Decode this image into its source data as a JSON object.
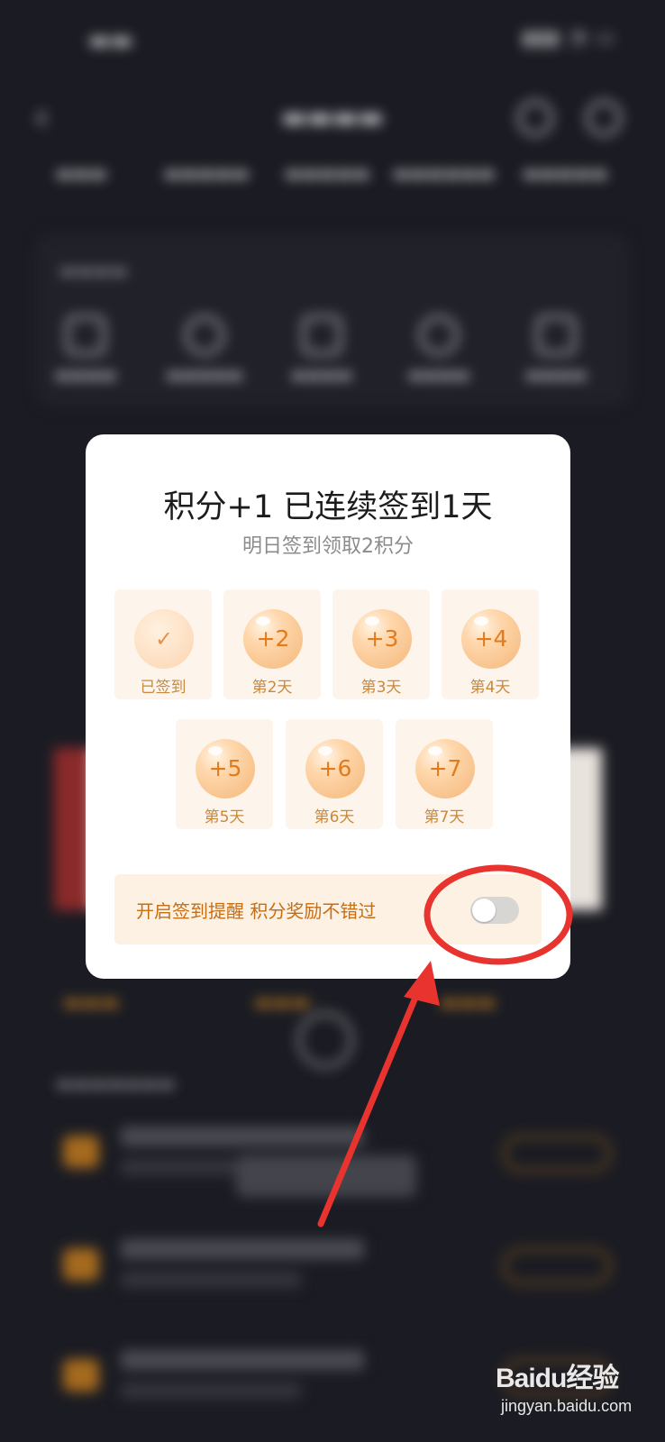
{
  "dialog": {
    "title": "积分+1 已连续签到1天",
    "subtitle": "明日签到领取2积分",
    "days": [
      {
        "reward": "✓",
        "label": "已签到",
        "signed": true
      },
      {
        "reward": "+2",
        "label": "第2天",
        "signed": false
      },
      {
        "reward": "+3",
        "label": "第3天",
        "signed": false
      },
      {
        "reward": "+4",
        "label": "第4天",
        "signed": false
      },
      {
        "reward": "+5",
        "label": "第5天",
        "signed": false
      },
      {
        "reward": "+6",
        "label": "第6天",
        "signed": false
      },
      {
        "reward": "+7",
        "label": "第7天",
        "signed": false
      }
    ],
    "reminder_text": "开启签到提醒 积分奖励不错过",
    "reminder_on": false
  },
  "watermark": {
    "brand": "Baidu经验",
    "url": "jingyan.baidu.com"
  },
  "colors": {
    "accent": "#e07c1d",
    "annotation": "#e8332f"
  }
}
